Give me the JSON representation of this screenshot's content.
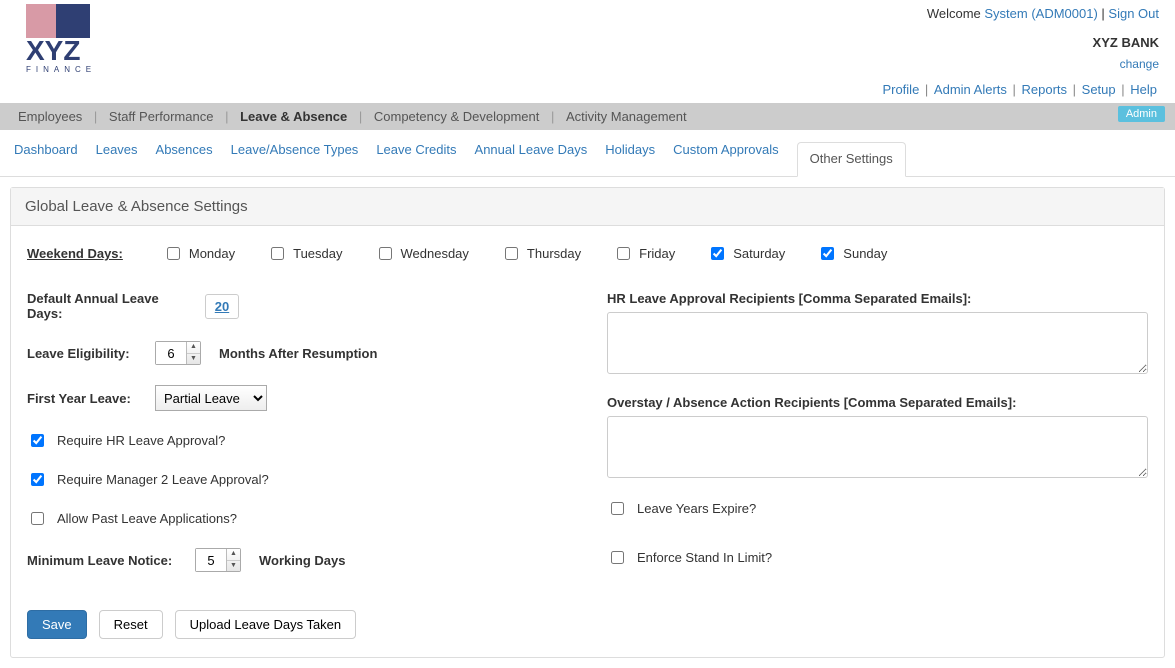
{
  "header": {
    "welcome_prefix": "Welcome ",
    "user_link": "System (ADM0001)",
    "signout": "Sign Out",
    "org_name": "XYZ BANK",
    "change": "change",
    "links": [
      "Profile",
      "Admin Alerts",
      "Reports",
      "Setup",
      "Help"
    ],
    "logo_text_top": "XYZ",
    "logo_text_bottom": "F I N A N C E"
  },
  "main_nav": {
    "items": [
      "Employees",
      "Staff Performance",
      "Leave & Absence",
      "Competency & Development",
      "Activity Management"
    ],
    "active_index": 2,
    "badge": "Admin"
  },
  "sub_tabs": {
    "items": [
      "Dashboard",
      "Leaves",
      "Absences",
      "Leave/Absence Types",
      "Leave Credits",
      "Annual Leave Days",
      "Holidays",
      "Custom Approvals",
      "Other Settings"
    ],
    "active_index": 8
  },
  "panel": {
    "title": "Global Leave & Absence Settings"
  },
  "weekend": {
    "label": "Weekend Days:",
    "days": [
      {
        "name": "Monday",
        "checked": false
      },
      {
        "name": "Tuesday",
        "checked": false
      },
      {
        "name": "Wednesday",
        "checked": false
      },
      {
        "name": "Thursday",
        "checked": false
      },
      {
        "name": "Friday",
        "checked": false
      },
      {
        "name": "Saturday",
        "checked": true
      },
      {
        "name": "Sunday",
        "checked": true
      }
    ]
  },
  "form": {
    "default_annual_label": "Default Annual Leave Days:",
    "default_annual_value": "20",
    "eligibility_label": "Leave Eligibility:",
    "eligibility_value": "6",
    "eligibility_suffix": "Months After Resumption",
    "first_year_label": "First Year Leave:",
    "first_year_value": "Partial Leave",
    "first_year_options": [
      "Partial Leave"
    ],
    "require_hr_label": "Require HR Leave Approval?",
    "require_hr_checked": true,
    "require_mgr2_label": "Require Manager 2 Leave Approval?",
    "require_mgr2_checked": true,
    "allow_past_label": "Allow Past Leave Applications?",
    "allow_past_checked": false,
    "min_notice_label": "Minimum Leave Notice:",
    "min_notice_value": "5",
    "min_notice_suffix": "Working Days",
    "hr_recipients_label": "HR Leave Approval Recipients [Comma Separated Emails]:",
    "hr_recipients_value": "",
    "overstay_label": "Overstay / Absence Action Recipients [Comma Separated Emails]:",
    "overstay_value": "",
    "leave_years_expire_label": "Leave Years Expire?",
    "leave_years_expire_checked": false,
    "enforce_standin_label": "Enforce Stand In Limit?",
    "enforce_standin_checked": false
  },
  "buttons": {
    "save": "Save",
    "reset": "Reset",
    "upload": "Upload Leave Days Taken"
  }
}
